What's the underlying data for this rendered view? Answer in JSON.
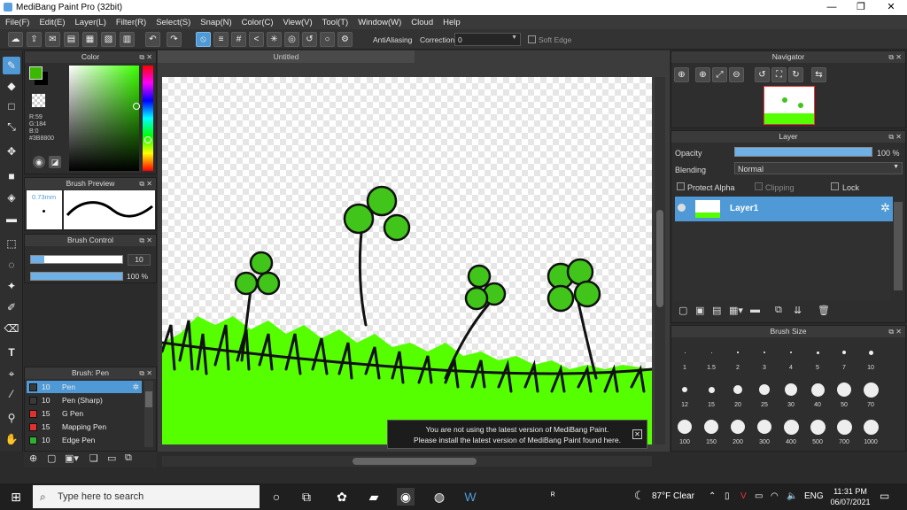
{
  "app": {
    "title": "MediBang Paint Pro (32bit)"
  },
  "menu": [
    "File(F)",
    "Edit(E)",
    "Layer(L)",
    "Filter(R)",
    "Select(S)",
    "Snap(N)",
    "Color(C)",
    "View(V)",
    "Tool(T)",
    "Window(W)",
    "Cloud",
    "Help"
  ],
  "toolbar": {
    "antialiasing_label": "AntiAliasing",
    "correction_label": "Correction",
    "correction_value": "0",
    "soft_edge_label": "Soft Edge"
  },
  "color_panel": {
    "title": "Color",
    "r": "R:59",
    "g": "G:184",
    "b": "B:0",
    "hex": "#3B8800",
    "fg_color": "#3bb800",
    "bg_color": "#000000"
  },
  "brush_preview": {
    "title": "Brush Preview",
    "size": "0.73mm"
  },
  "brush_control": {
    "title": "Brush Control",
    "size_value": "10",
    "opacity_value": "100 %",
    "size_fraction": 0.15,
    "opacity_fraction": 1.0
  },
  "brush_list": {
    "title": "Brush: Pen",
    "items": [
      {
        "size": "10",
        "name": "Pen",
        "color": "#3a3a3a",
        "selected": true
      },
      {
        "size": "10",
        "name": "Pen (Sharp)",
        "color": "#3a3a3a",
        "selected": false
      },
      {
        "size": "15",
        "name": "G Pen",
        "color": "#e03030",
        "selected": false
      },
      {
        "size": "15",
        "name": "Mapping Pen",
        "color": "#e03030",
        "selected": false
      },
      {
        "size": "10",
        "name": "Edge Pen",
        "color": "#30b030",
        "selected": false
      }
    ]
  },
  "document": {
    "tab": "Untitled"
  },
  "notice": {
    "line1": "You are not using the latest version of MediBang Paint.",
    "line2": "Please install the latest version of MediBang Paint found here."
  },
  "navigator": {
    "title": "Navigator"
  },
  "layer_panel": {
    "title": "Layer",
    "opacity_label": "Opacity",
    "opacity_value": "100 %",
    "blending_label": "Blending",
    "blending_value": "Normal",
    "protect_alpha": "Protect Alpha",
    "clipping": "Clipping",
    "lock": "Lock",
    "layer_name": "Layer1"
  },
  "brush_size": {
    "title": "Brush Size",
    "row1": [
      "1",
      "1.5",
      "2",
      "3",
      "4",
      "5",
      "7",
      "10"
    ],
    "row2": [
      "12",
      "15",
      "20",
      "25",
      "30",
      "40",
      "50",
      "70"
    ],
    "row3": [
      "100",
      "150",
      "200",
      "300",
      "400",
      "500",
      "700",
      "1000"
    ]
  },
  "taskbar": {
    "search_placeholder": "Type here to search",
    "weather": "87°F  Clear",
    "lang": "ENG",
    "time": "11:31 PM",
    "date": "06/07/2021"
  }
}
